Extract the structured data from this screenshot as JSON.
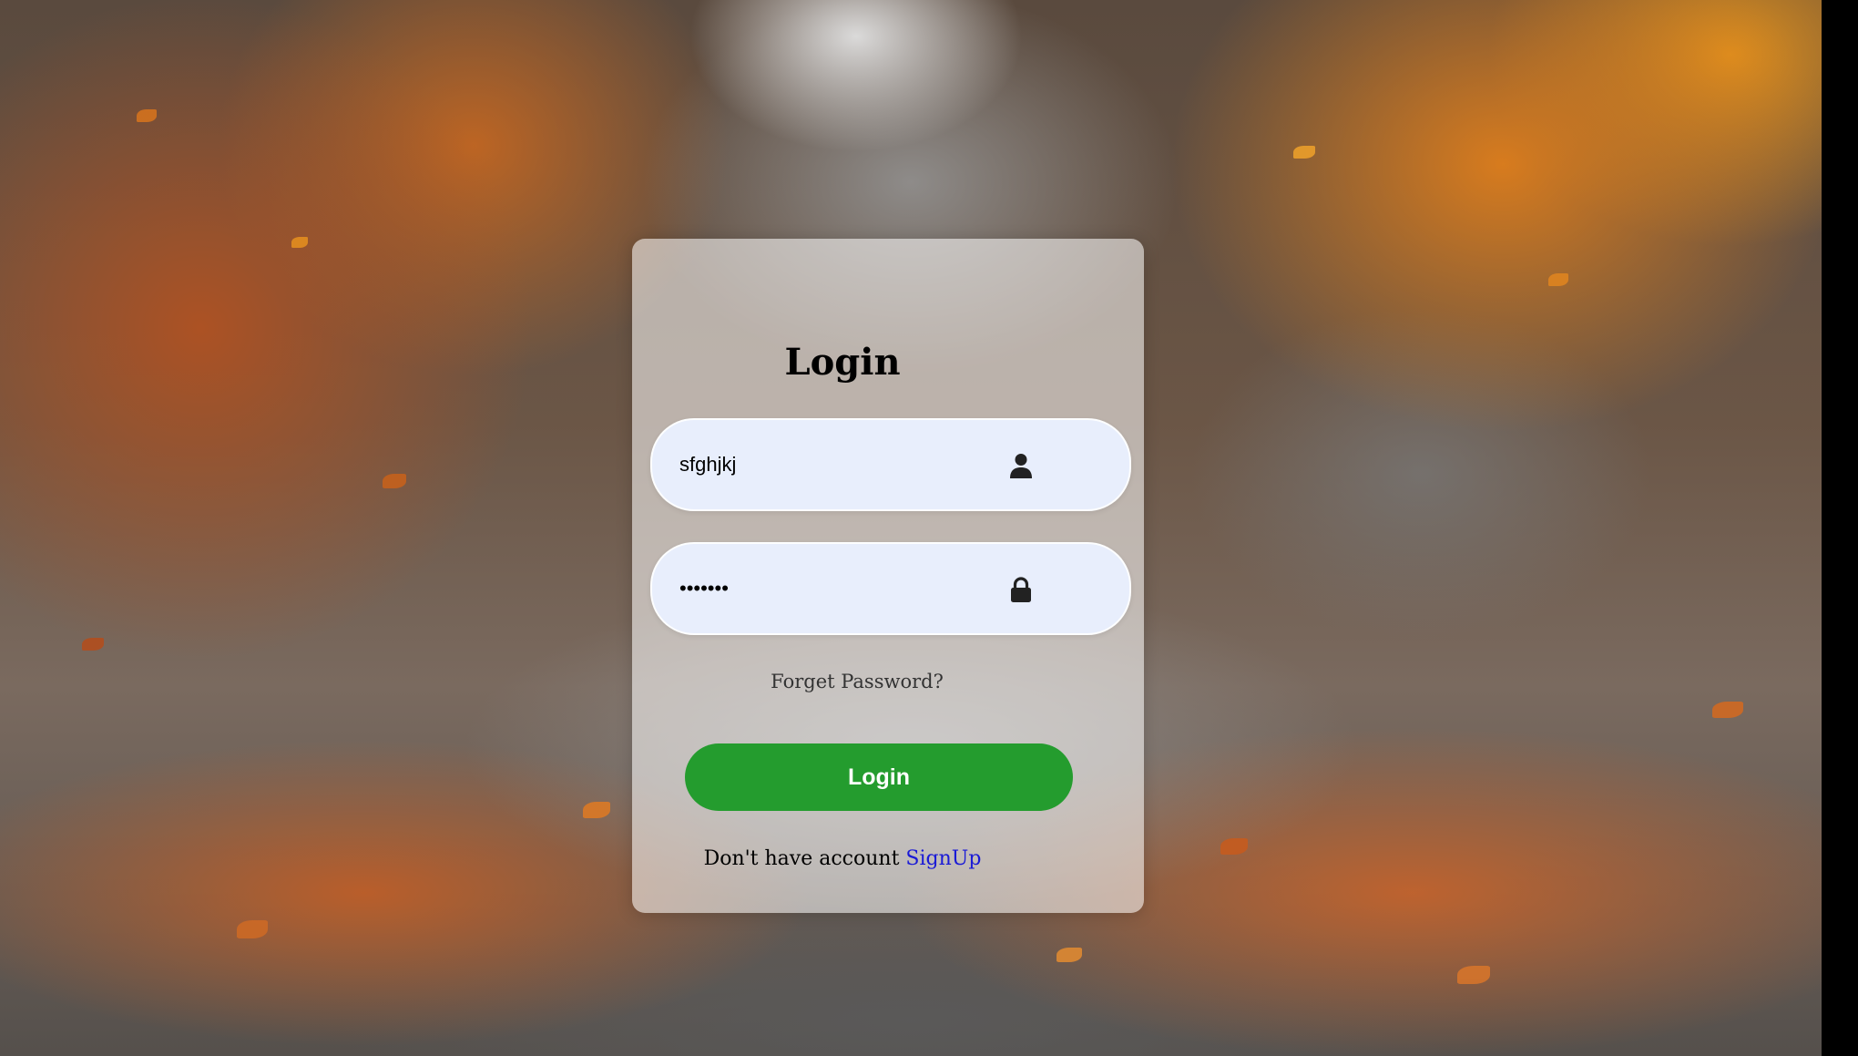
{
  "page": {
    "title": "Login"
  },
  "form": {
    "username_value": "sfghjkj",
    "password_value": "sfghjkj",
    "forgot_label": "Forget Password?",
    "login_button_label": "Login",
    "signup_prompt": "Don't have account ",
    "signup_link_label": "SignUp"
  },
  "icons": {
    "username": "user-icon",
    "password": "lock-icon"
  },
  "colors": {
    "login_button": "#249c2e",
    "signup_link": "#1a1ad6",
    "field_background": "#e8eefc"
  }
}
